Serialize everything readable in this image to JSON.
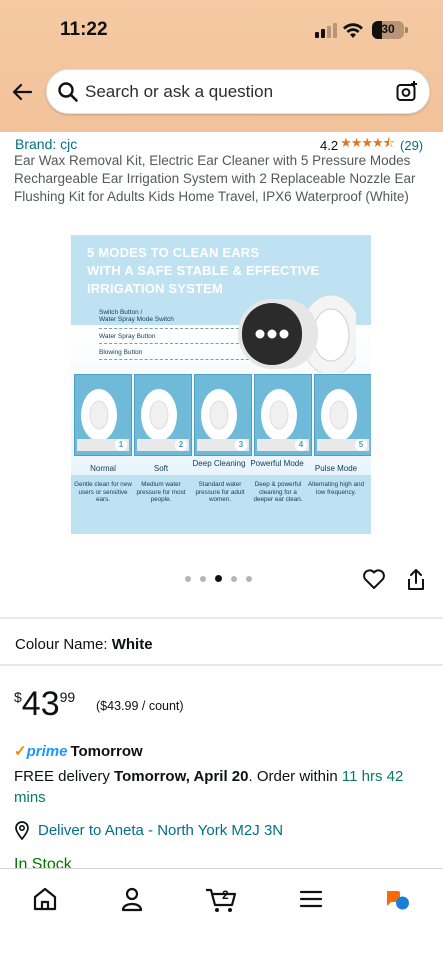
{
  "status": {
    "time": "11:22",
    "battery": "30"
  },
  "search": {
    "placeholder": "Search or ask a question"
  },
  "product": {
    "brand": "Brand: cjc",
    "rating": "4.2",
    "stars": "★★★★⯪",
    "review_count": "(29)",
    "title": "Ear Wax Removal Kit, Electric Ear Cleaner with 5 Pressure Modes Rechargeable Ear Irrigation System with 2 Replaceable Nozzle Ear Flushing Kit for Adults Kids Home Travel,  IPX6 Waterproof (White)"
  },
  "image": {
    "headline_1": "5 MODES TO CLEAN EARS",
    "headline_2": "WITH A SAFE STABLE & EFFECTIVE",
    "headline_3": "IRRIGATION SYSTEM",
    "feature_1a": "Switch Button /",
    "feature_1b": "Water Spray Mode Switch",
    "feature_2": "Water Spray Button",
    "feature_3": "Blowing Button",
    "modes": [
      {
        "num": "1",
        "name": "Normal",
        "desc": "Gentle clean for new users or sensitive ears."
      },
      {
        "num": "2",
        "name": "Soft",
        "desc": "Medium water pressure for most people."
      },
      {
        "num": "3",
        "name": "Deep Cleaning",
        "desc": "Standard water pressure for adult women."
      },
      {
        "num": "4",
        "name": "Powerful Mode",
        "desc": "Deep & powerful cleaning for a deeper ear clean."
      },
      {
        "num": "5",
        "name": "Pulse Mode",
        "desc": "Alternating high and low frequency."
      }
    ]
  },
  "carousel": {
    "active_index": 3,
    "count": 5
  },
  "colour": {
    "label": "Colour Name:",
    "value": "White"
  },
  "price": {
    "currency": "$",
    "whole": "43",
    "fraction": "99",
    "unit": "($43.99 / count)"
  },
  "prime": {
    "brand": "prime",
    "day": "Tomorrow"
  },
  "delivery": {
    "prefix": "FREE delivery",
    "date": "Tomorrow, April 20",
    "order_within": ". Order within ",
    "time_left": "11 hrs 42 mins"
  },
  "location": "Deliver to Aneta - North York M2J 3N",
  "stock": "In Stock",
  "nav": {
    "cart_count": "2"
  },
  "colors": {
    "header_bg": "#f3c49c",
    "link": "#007185",
    "star": "#de7921",
    "prime_blue": "#1a98ff",
    "green": "#067d62"
  }
}
